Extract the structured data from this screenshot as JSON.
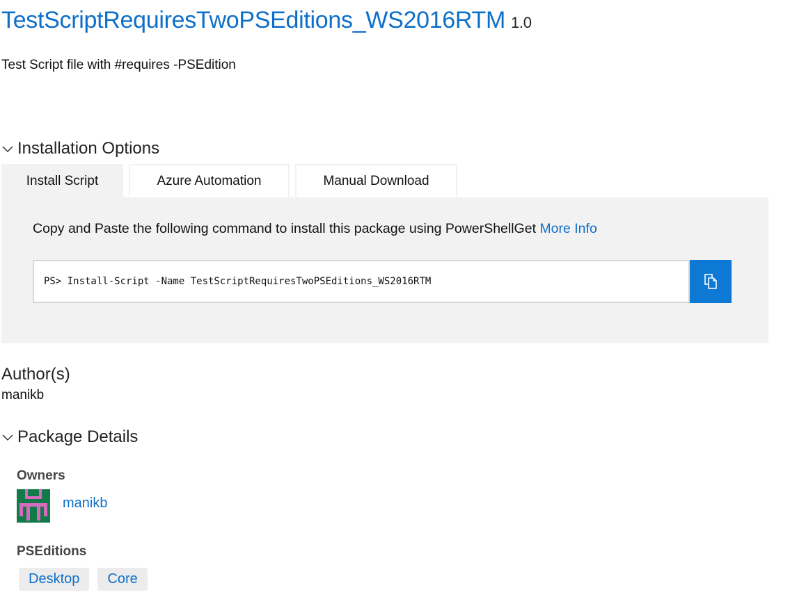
{
  "package": {
    "name": "TestScriptRequiresTwoPSEditions_WS2016RTM",
    "version": "1.0",
    "description": "Test Script file with #requires -PSEdition"
  },
  "installation": {
    "heading": "Installation Options",
    "tabs": [
      {
        "label": "Install Script",
        "active": true
      },
      {
        "label": "Azure Automation",
        "active": false
      },
      {
        "label": "Manual Download",
        "active": false
      }
    ],
    "instruction": "Copy and Paste the following command to install this package using PowerShellGet",
    "more_info_label": "More Info",
    "command": "PS> Install-Script -Name TestScriptRequiresTwoPSEditions_WS2016RTM"
  },
  "authors": {
    "heading": "Author(s)",
    "value": "manikb"
  },
  "details": {
    "heading": "Package Details",
    "owners_label": "Owners",
    "owner_name": "manikb",
    "pseditions_label": "PSEditions",
    "pseditions": [
      "Desktop",
      "Core"
    ]
  },
  "colors": {
    "accent": "#0e6fc9",
    "copy_button": "#0e78d5",
    "panel_bg": "#f2f2f2",
    "avatar_green": "#117a48",
    "avatar_pink": "#d66bbd"
  },
  "icons": {
    "section_toggle": "chevron-down-icon",
    "copy": "copy-icon"
  }
}
